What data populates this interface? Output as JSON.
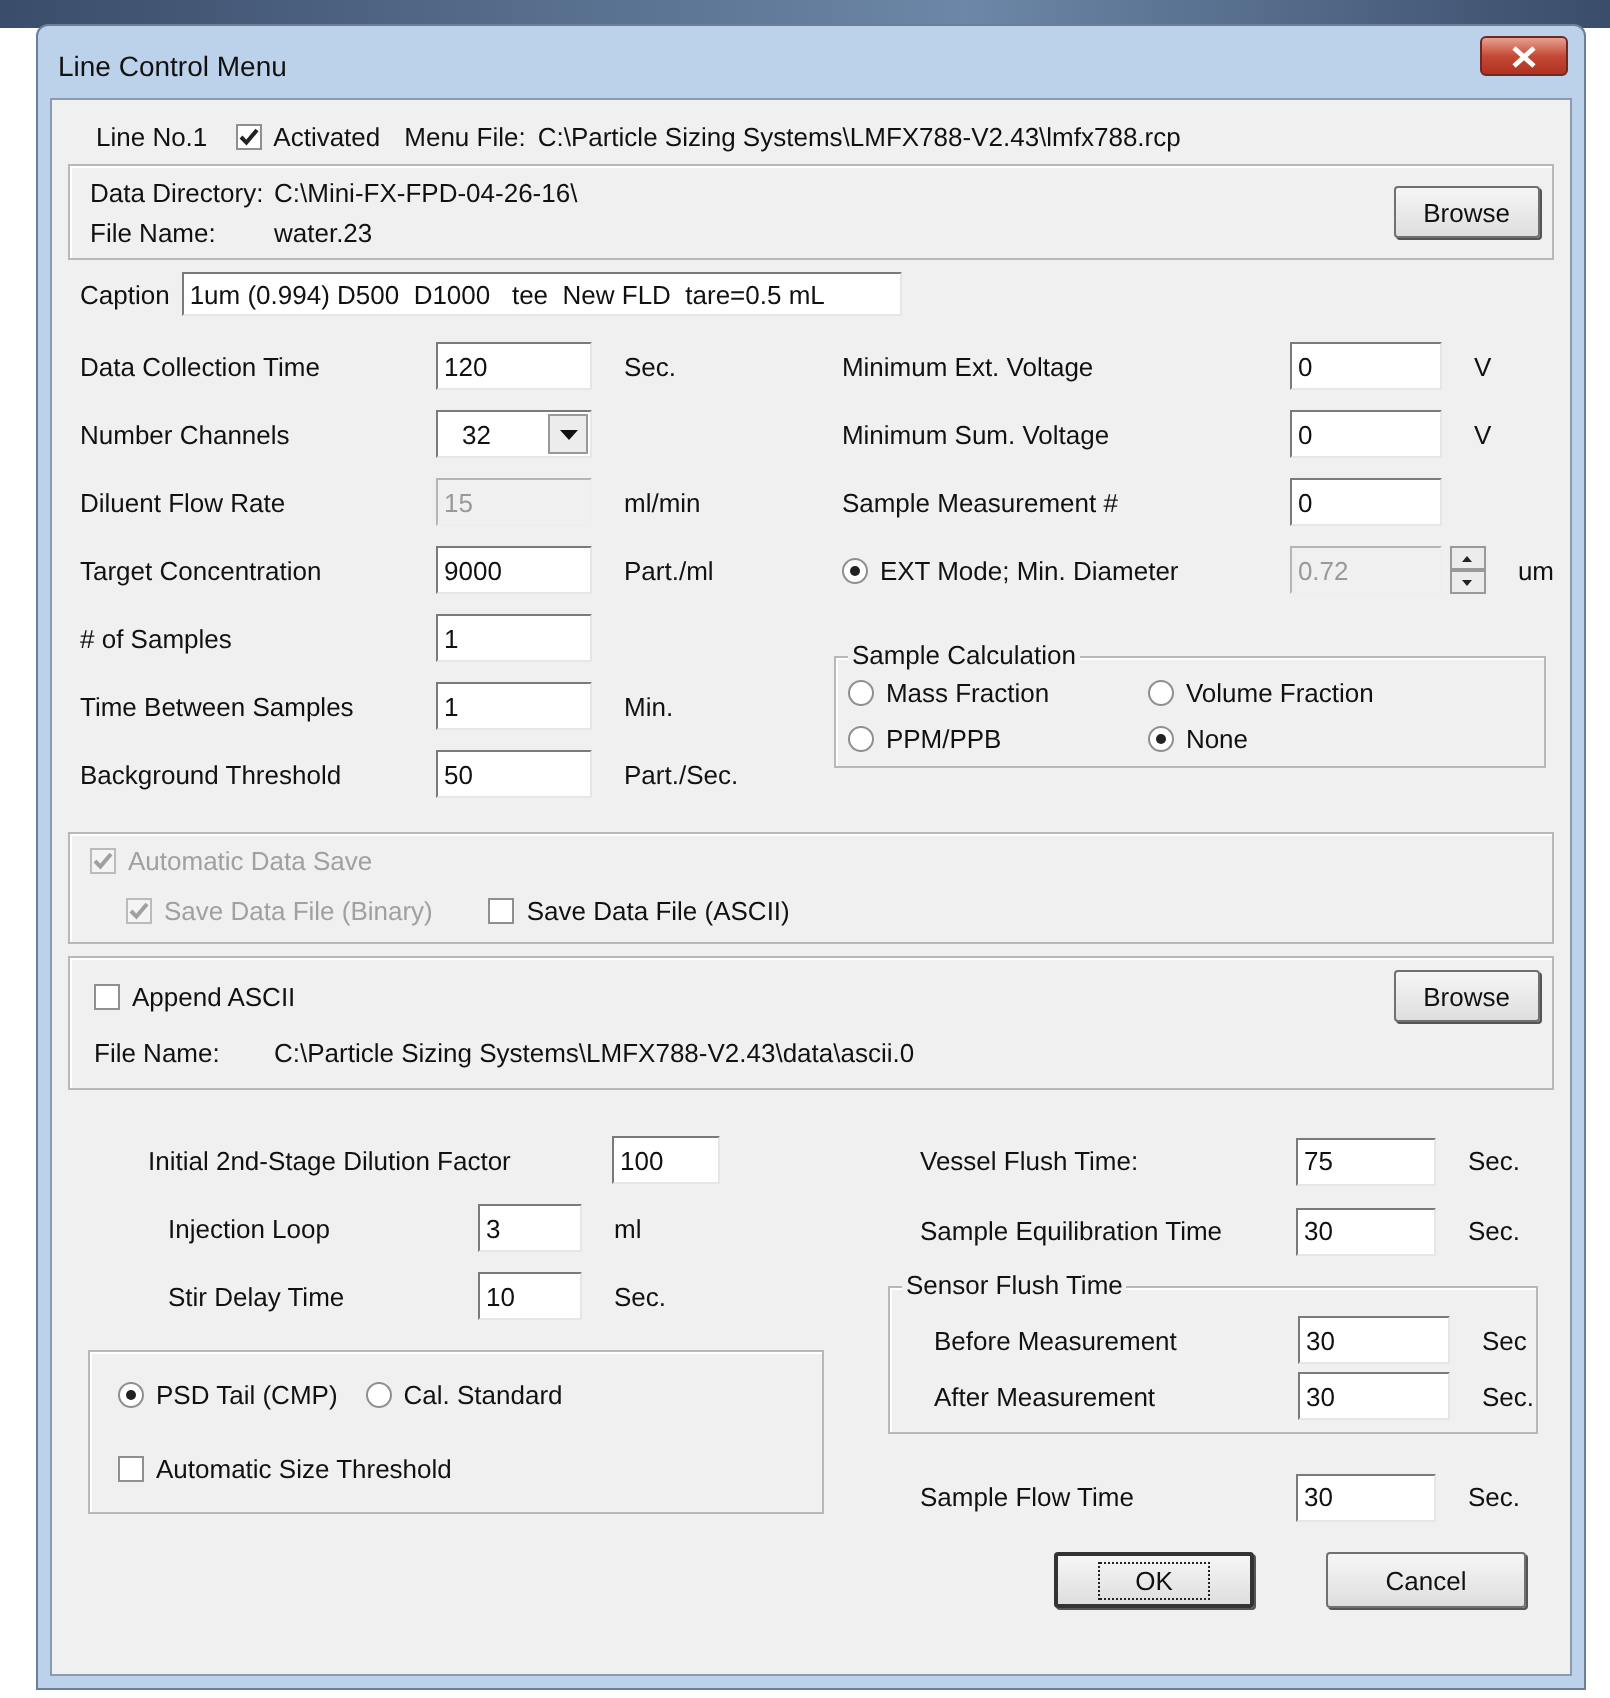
{
  "window": {
    "title": "Line Control Menu"
  },
  "header": {
    "line_label": "Line No.1",
    "activated": {
      "label": "Activated",
      "checked": true
    },
    "menu_file_label": "Menu File:",
    "menu_file": "C:\\Particle Sizing Systems\\LMFX788-V2.43\\lmfx788.rcp"
  },
  "data_directory": {
    "rows": [
      {
        "label": "Data Directory:",
        "value": "C:\\Mini-FX-FPD-04-26-16\\"
      },
      {
        "label": "File Name:",
        "value": "water.23"
      }
    ],
    "button": "Browse"
  },
  "caption": {
    "label": "Caption",
    "value": "1um (0.994) D500  D1000   tee  New FLD  tare=0.5 mL"
  },
  "left_fields": [
    {
      "kind": "text",
      "label": "Data Collection Time",
      "value": "120",
      "unit": "Sec.",
      "disabled": false
    },
    {
      "kind": "dropdown",
      "label": "Number Channels",
      "value": "32",
      "disabled": false
    },
    {
      "kind": "text",
      "label": "Diluent Flow Rate",
      "value": "15",
      "unit": "ml/min",
      "disabled": true
    },
    {
      "kind": "text",
      "label": "Target Concentration",
      "value": "9000",
      "unit": "Part./ml",
      "disabled": false
    },
    {
      "kind": "text",
      "label": "# of  Samples",
      "value": "1",
      "disabled": false
    },
    {
      "kind": "text",
      "label": "Time Between Samples",
      "value": "1",
      "unit": "Min.",
      "disabled": false
    },
    {
      "kind": "text",
      "label": "Background Threshold",
      "value": "50",
      "unit": "Part./Sec.",
      "disabled": false
    }
  ],
  "right_fields": [
    {
      "kind": "text",
      "label": "Minimum Ext. Voltage",
      "value": "0",
      "unit": "V",
      "disabled": false
    },
    {
      "kind": "text",
      "label": "Minimum Sum. Voltage",
      "value": "0",
      "unit": "V",
      "disabled": false
    },
    {
      "kind": "text",
      "label": "Sample Measurement #",
      "value": "0",
      "disabled": false
    },
    {
      "kind": "radio_spin",
      "label": "EXT Mode; Min. Diameter",
      "selected": true,
      "value": "0.72",
      "unit": "um",
      "disabled": true
    }
  ],
  "sample_calculation": {
    "title": "Sample Calculation",
    "options": [
      {
        "label": "Mass Fraction",
        "selected": false
      },
      {
        "label": "Volume Fraction",
        "selected": false
      },
      {
        "label": "PPM/PPB",
        "selected": false
      },
      {
        "label": "None",
        "selected": true
      }
    ]
  },
  "auto_save": {
    "label": "Automatic Data Save",
    "checked": true,
    "disabled": true,
    "options": [
      {
        "label": "Save Data File (Binary)",
        "checked": true,
        "disabled": true
      },
      {
        "label": "Save Data File (ASCII)",
        "checked": false,
        "disabled": false
      }
    ]
  },
  "append_ascii": {
    "label": "Append ASCII",
    "checked": false,
    "button": "Browse",
    "file_label": "File Name:",
    "file_value": "C:\\Particle Sizing Systems\\LMFX788-V2.43\\data\\ascii.0"
  },
  "bottom_left_fields": [
    {
      "kind": "text",
      "label": "Initial 2nd-Stage Dilution Factor",
      "value": "100",
      "disabled": false
    },
    {
      "kind": "text",
      "label": "Injection Loop",
      "value": "3",
      "unit": "ml",
      "disabled": false
    },
    {
      "kind": "text",
      "label": "Stir Delay Time",
      "value": "10",
      "unit": "Sec.",
      "disabled": false
    }
  ],
  "psd_mode": {
    "options": [
      {
        "label": "PSD Tail (CMP)",
        "selected": true
      },
      {
        "label": "Cal. Standard",
        "selected": false
      }
    ],
    "auto_threshold": {
      "label": "Automatic Size Threshold",
      "checked": false
    }
  },
  "bottom_right_fields": [
    {
      "kind": "text",
      "label": "Vessel Flush Time:",
      "value": "75",
      "unit": "Sec.",
      "disabled": false
    },
    {
      "kind": "text",
      "label": "Sample Equilibration Time",
      "value": "30",
      "unit": "Sec.",
      "disabled": false
    }
  ],
  "sensor_flush": {
    "title": "Sensor Flush Time",
    "fields": [
      {
        "kind": "text",
        "label": "Before Measurement",
        "value": "30",
        "unit": "Sec",
        "disabled": false
      },
      {
        "kind": "text",
        "label": "After Measurement",
        "value": "30",
        "unit": "Sec.",
        "disabled": false
      }
    ]
  },
  "sample_flow": [
    {
      "kind": "text",
      "label": "Sample Flow Time",
      "value": "30",
      "unit": "Sec.",
      "disabled": false
    }
  ],
  "buttons": [
    {
      "label": "OK",
      "focused": true
    },
    {
      "label": "Cancel",
      "focused": false
    }
  ]
}
